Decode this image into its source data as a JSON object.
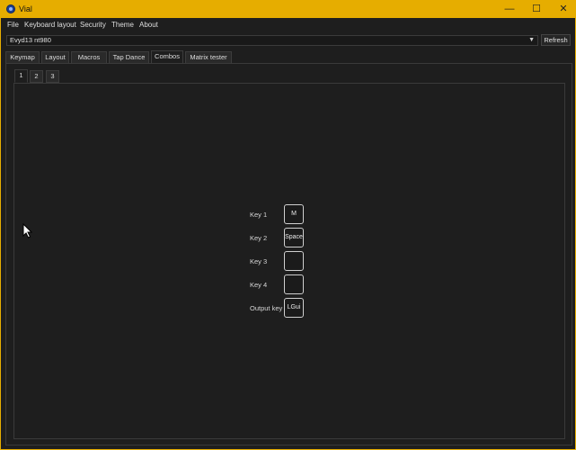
{
  "titlebar": {
    "title": "Vial",
    "minimize": "—",
    "maximize": "☐",
    "close": "✕"
  },
  "menubar": {
    "items": [
      "File",
      "Keyboard layout",
      "Security",
      "Theme",
      "About"
    ]
  },
  "device": {
    "selected": "Evyd13 nt980",
    "refresh_label": "Refresh"
  },
  "tabs": [
    "Keymap",
    "Layout",
    "Macros",
    "Tap Dance",
    "Combos",
    "Matrix tester"
  ],
  "active_tab": "Combos",
  "combo_tabs": [
    "1",
    "2",
    "3"
  ],
  "active_combo_tab": "1",
  "combo": {
    "rows": [
      {
        "label": "Key 1",
        "key": "M"
      },
      {
        "label": "Key 2",
        "key": "Space"
      },
      {
        "label": "Key 3",
        "key": ""
      },
      {
        "label": "Key 4",
        "key": ""
      },
      {
        "label": "Output key",
        "key": "LGui"
      }
    ]
  },
  "colors": {
    "titlebar": "#e6ad00",
    "background": "#1e1e1e"
  }
}
